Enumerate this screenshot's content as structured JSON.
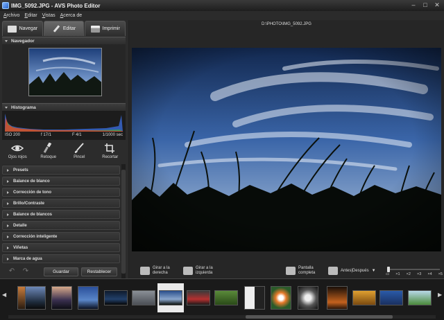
{
  "window": {
    "title": "IMG_5092.JPG  -  AVS Photo Editor"
  },
  "menu": [
    "Archivo",
    "Editar",
    "Vistas",
    "Acerca de"
  ],
  "tabs": [
    {
      "label": "Navegar",
      "icon": "folder-icon"
    },
    {
      "label": "Editar",
      "icon": "pencil-icon",
      "active": true
    },
    {
      "label": "Imprimir",
      "icon": "printer-icon"
    }
  ],
  "navigator": {
    "title": "Navegador"
  },
  "histogram": {
    "title": "Histograma",
    "iso": "ISO 200",
    "aperture1": "f 17/1",
    "aperture2": "F 4/1",
    "shutter": "1/1000 sec"
  },
  "tools": [
    {
      "label": "Ojos rojos",
      "icon": "eye-icon"
    },
    {
      "label": "Retoque",
      "icon": "brush-retouch-icon"
    },
    {
      "label": "Pincel",
      "icon": "paintbrush-icon"
    },
    {
      "label": "Recortar",
      "icon": "crop-icon"
    }
  ],
  "adjustments": [
    "Presets",
    "Balance de blanco",
    "Corrección de tono",
    "Brillo/Contraste",
    "Balance de blancos",
    "Detalle",
    "Corrección inteligente",
    "Viñetas",
    "Marca de agua"
  ],
  "actions": {
    "save": "Guardar",
    "reset": "Restablecer"
  },
  "path": "D:\\PHOTO\\IMG_5092.JPG",
  "toolbar": {
    "rotate_right": "Girar a la derecha",
    "rotate_left": "Girar a la izquierda",
    "fullscreen": "Pantalla completa",
    "before_after": "Antes|Después"
  },
  "zoom": {
    "levels": [
      "×1",
      "×2",
      "×3",
      "×4",
      "×5"
    ]
  }
}
